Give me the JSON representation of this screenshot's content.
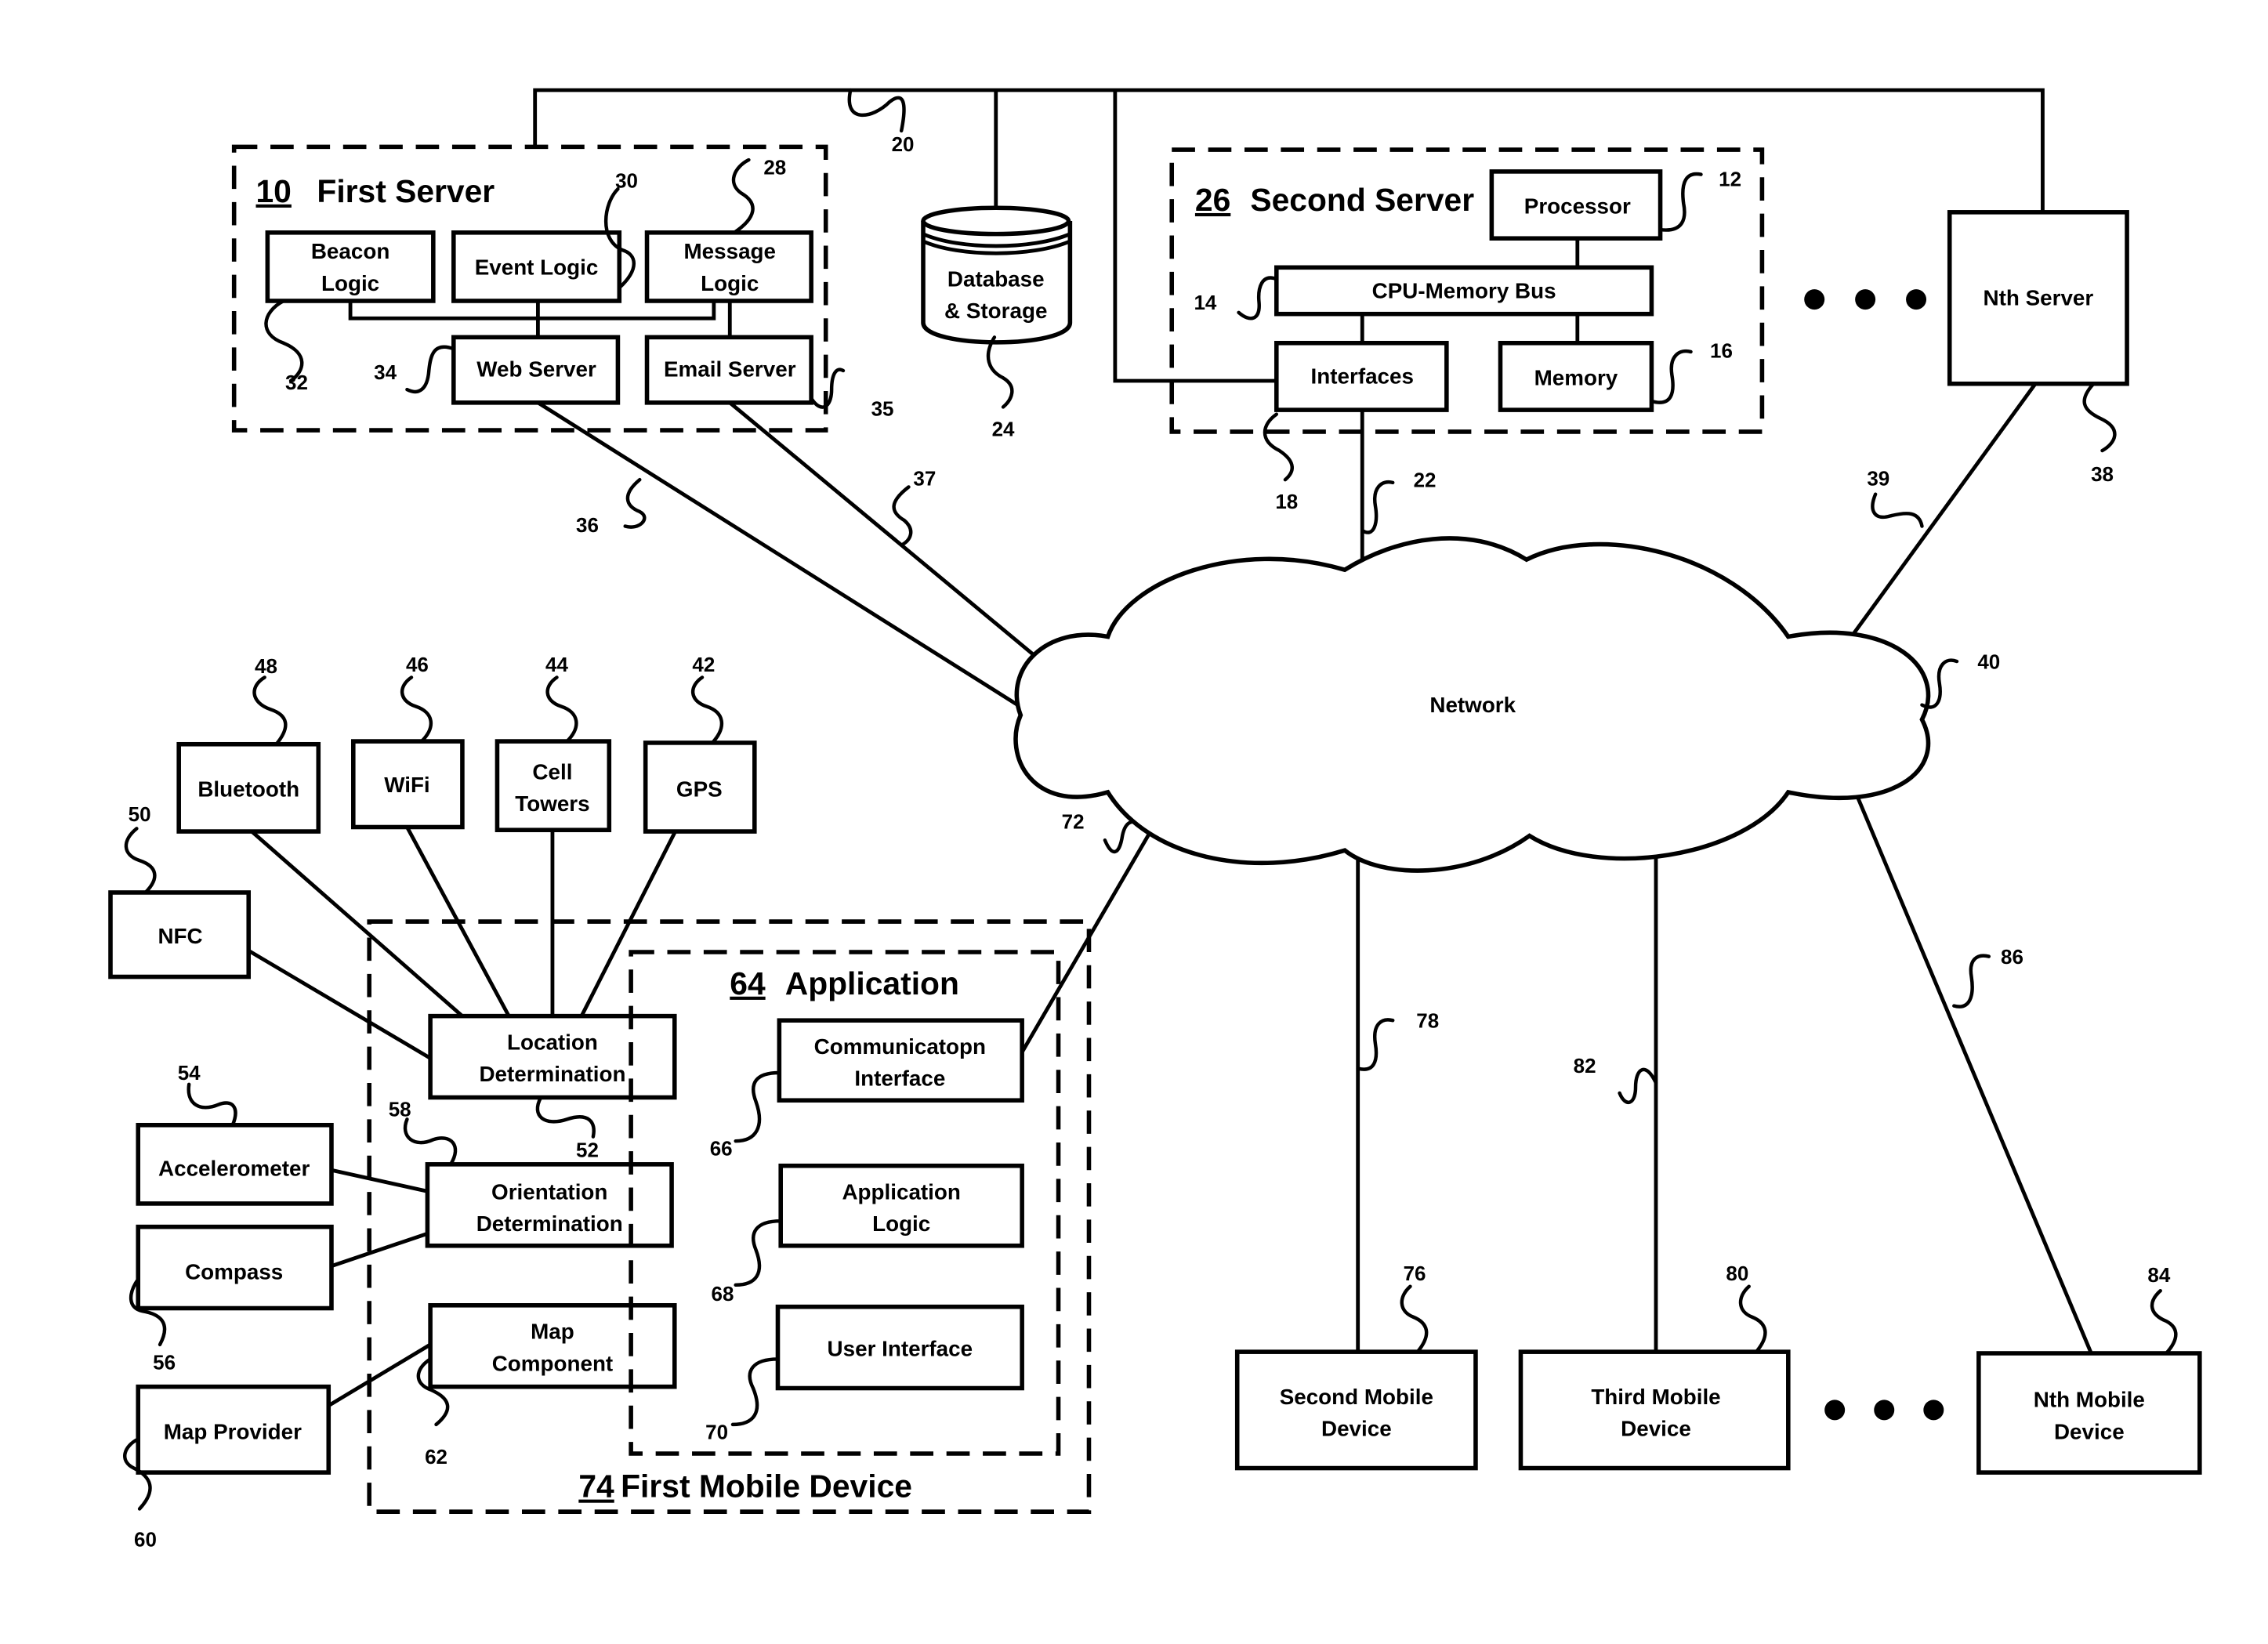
{
  "colors": {
    "stroke": "#000000",
    "background": "#ffffff"
  },
  "first_server": {
    "ref": "10",
    "title": "First Server",
    "components": [
      {
        "id": "beacon",
        "lines": [
          "Beacon",
          "Logic"
        ],
        "ref": "32"
      },
      {
        "id": "event",
        "lines": [
          "Event Logic"
        ],
        "ref": "30"
      },
      {
        "id": "message",
        "lines": [
          "Message",
          "Logic"
        ],
        "ref": "28"
      },
      {
        "id": "web",
        "lines": [
          "Web Server"
        ],
        "ref": "34"
      },
      {
        "id": "email",
        "lines": [
          "Email Server"
        ],
        "ref": "35"
      }
    ]
  },
  "database": {
    "lines": [
      "Database",
      "& Storage"
    ],
    "ref": "24"
  },
  "bus_ref": "20",
  "second_server": {
    "ref": "26",
    "title": "Second Server",
    "components": [
      {
        "id": "processor",
        "lines": [
          "Processor"
        ],
        "ref": "12"
      },
      {
        "id": "cpu_bus",
        "lines": [
          "CPU-Memory Bus"
        ],
        "ref": "14"
      },
      {
        "id": "interfaces",
        "lines": [
          "Interfaces"
        ],
        "ref": "18"
      },
      {
        "id": "memory",
        "lines": [
          "Memory"
        ],
        "ref": "16"
      }
    ]
  },
  "nth_server": {
    "lines": [
      "Nth Server"
    ],
    "ref": "38"
  },
  "network": {
    "label": "Network",
    "ref": "40"
  },
  "links": {
    "web_to_network": "36",
    "email_to_network": "37",
    "second_to_network": "22",
    "nth_to_network": "39",
    "first_mobile_to_network": "72",
    "second_mobile_link": "78",
    "third_mobile_link": "82",
    "nth_mobile_link": "86"
  },
  "sensors": [
    {
      "id": "bluetooth",
      "lines": [
        "Bluetooth"
      ],
      "ref": "48"
    },
    {
      "id": "wifi",
      "lines": [
        "WiFi"
      ],
      "ref": "46"
    },
    {
      "id": "cell",
      "lines": [
        "Cell",
        "Towers"
      ],
      "ref": "44"
    },
    {
      "id": "gps",
      "lines": [
        "GPS"
      ],
      "ref": "42"
    },
    {
      "id": "nfc",
      "lines": [
        "NFC"
      ],
      "ref": "50"
    },
    {
      "id": "accelerometer",
      "lines": [
        "Accelerometer"
      ],
      "ref": "54"
    },
    {
      "id": "compass",
      "lines": [
        "Compass"
      ],
      "ref": "56"
    },
    {
      "id": "map_provider",
      "lines": [
        "Map Provider"
      ],
      "ref": "60"
    }
  ],
  "first_mobile": {
    "ref": "74",
    "title": "First Mobile Device",
    "components": [
      {
        "id": "location",
        "lines": [
          "Location",
          "Determination"
        ],
        "ref": "52"
      },
      {
        "id": "orientation",
        "lines": [
          "Orientation",
          "Determination"
        ],
        "ref": "58"
      },
      {
        "id": "map_component",
        "lines": [
          "Map",
          "Component"
        ],
        "ref": "62"
      }
    ],
    "application": {
      "ref": "64",
      "title": "Application",
      "components": [
        {
          "id": "comm",
          "lines": [
            "Communicatopn",
            "Interface"
          ],
          "ref": "66"
        },
        {
          "id": "app_logic",
          "lines": [
            "Application",
            "Logic"
          ],
          "ref": "68"
        },
        {
          "id": "ui",
          "lines": [
            "User Interface"
          ],
          "ref": "70"
        }
      ]
    }
  },
  "mobile_devices": [
    {
      "id": "second",
      "lines": [
        "Second Mobile",
        "Device"
      ],
      "ref": "76"
    },
    {
      "id": "third",
      "lines": [
        "Third Mobile",
        "Device"
      ],
      "ref": "80"
    },
    {
      "id": "nth",
      "lines": [
        "Nth Mobile",
        "Device"
      ],
      "ref": "84"
    }
  ]
}
